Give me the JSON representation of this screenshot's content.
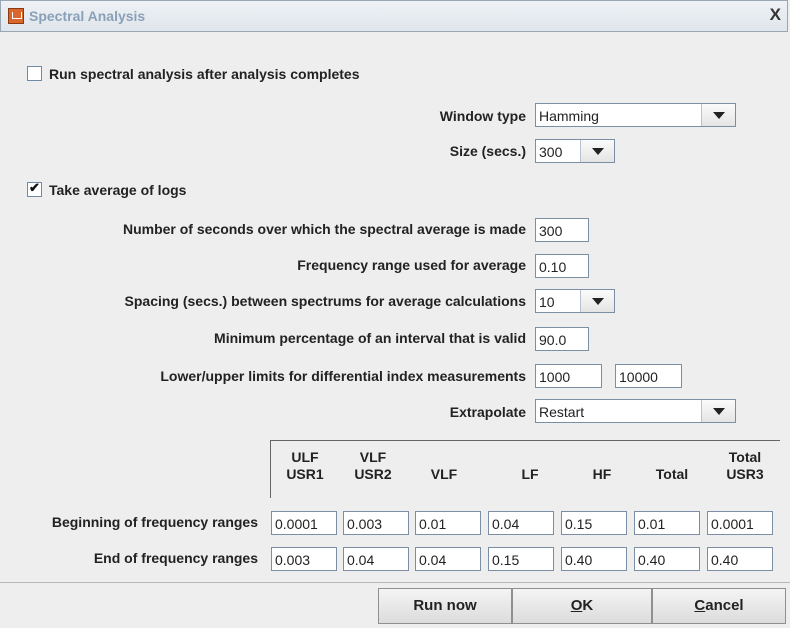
{
  "window": {
    "title": "Spectral Analysis",
    "close_label": "X"
  },
  "run_after": {
    "label": "Run spectral analysis after analysis completes",
    "checked": false
  },
  "window_type": {
    "label": "Window type",
    "value": "Hamming"
  },
  "size": {
    "label": "Size (secs.)",
    "value": "300"
  },
  "take_average": {
    "label": "Take average of logs",
    "checked": true
  },
  "avg_seconds": {
    "label": "Number of seconds over which the spectral average is made",
    "value": "300"
  },
  "freq_range": {
    "label": "Frequency range used for average",
    "value": "0.10"
  },
  "spacing": {
    "label": "Spacing (secs.) between spectrums for average calculations",
    "value": "10"
  },
  "min_pct": {
    "label": "Minimum percentage of an interval that is valid",
    "value": "90.0"
  },
  "limits": {
    "label": "Lower/upper limits for differential index measurements",
    "lower": "1000",
    "upper": "10000"
  },
  "extrapolate": {
    "label": "Extrapolate",
    "value": "Restart"
  },
  "ranges": {
    "headers": [
      [
        "ULF",
        "USR1"
      ],
      [
        "VLF",
        "USR2"
      ],
      [
        "",
        "VLF"
      ],
      [
        "",
        "LF"
      ],
      [
        "",
        "HF"
      ],
      [
        "",
        "Total"
      ],
      [
        "Total",
        "USR3"
      ]
    ],
    "begin_label": "Beginning of frequency ranges",
    "end_label": "End of frequency ranges",
    "begin": [
      "0.0001",
      "0.003",
      "0.01",
      "0.04",
      "0.15",
      "0.01",
      "0.0001"
    ],
    "end": [
      "0.003",
      "0.04",
      "0.04",
      "0.15",
      "0.40",
      "0.40",
      "0.40"
    ]
  },
  "buttons": {
    "run_now": "Run now",
    "ok_mnemonic": "O",
    "ok_rest": "K",
    "cancel_mnemonic": "C",
    "cancel_rest": "ancel"
  }
}
